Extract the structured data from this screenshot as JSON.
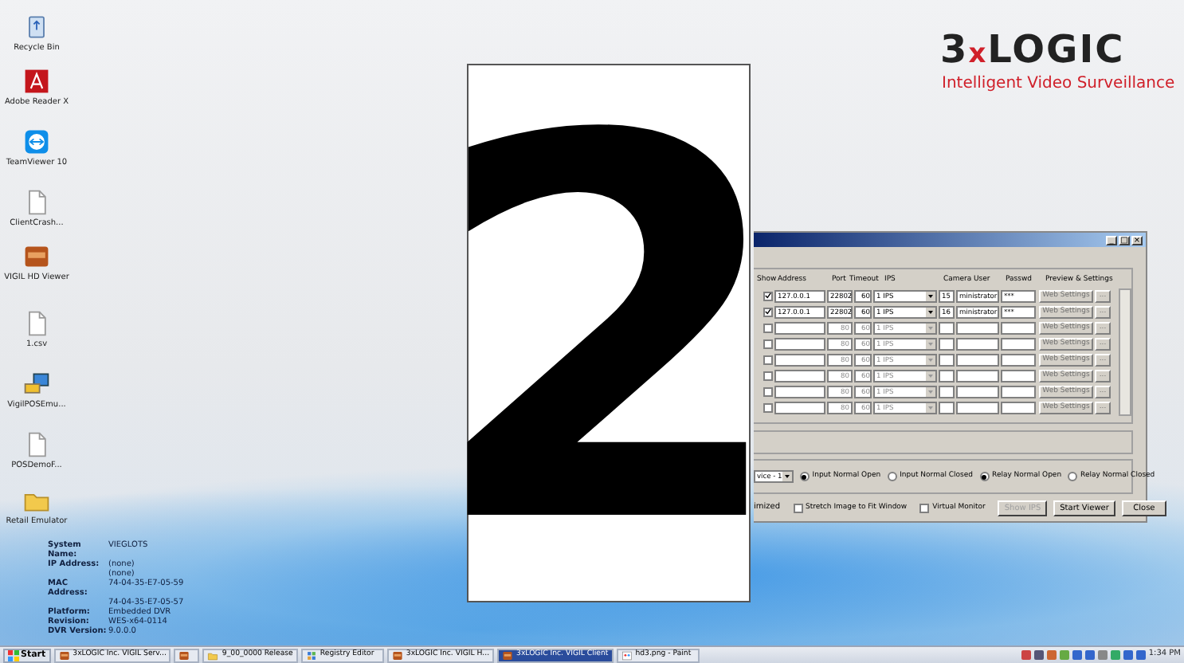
{
  "desktop_icons": [
    {
      "label": "Recycle Bin",
      "kind": "recycle"
    },
    {
      "label": "Adobe Reader X",
      "kind": "pdf"
    },
    {
      "label": "TeamViewer 10",
      "kind": "teamviewer"
    },
    {
      "label": "ClientCrash...",
      "kind": "file"
    },
    {
      "label": "VIGIL HD Viewer",
      "kind": "vigil"
    },
    {
      "label": "1.csv",
      "kind": "file"
    },
    {
      "label": "VigilPOSEmu...",
      "kind": "network"
    },
    {
      "label": "POSDemoF...",
      "kind": "file"
    },
    {
      "label": "Retail Emulator",
      "kind": "folder"
    }
  ],
  "system_info": [
    {
      "label": "System Name:",
      "values": [
        "VIEGLOTS"
      ]
    },
    {
      "label": "IP Address:",
      "values": [
        "(none)",
        "(none)"
      ]
    },
    {
      "label": "MAC Address:",
      "values": [
        "74-04-35-E7-05-59",
        "74-04-35-E7-05-57"
      ]
    },
    {
      "label": "Platform:",
      "values": [
        "Embedded DVR"
      ]
    },
    {
      "label": "Revision:",
      "values": [
        "WES-x64-0114"
      ]
    },
    {
      "label": "DVR Version:",
      "values": [
        "9.0.0.0"
      ]
    }
  ],
  "logo": {
    "before": "3",
    "accent": "x",
    "after": "LOGIC",
    "tagline": "Intelligent Video Surveillance"
  },
  "overlay": {
    "text": "2"
  },
  "dialog": {
    "title_buttons": [
      "_",
      "□",
      "×"
    ],
    "columns": [
      "Show",
      "Address",
      "Port",
      "Timeout",
      "IPS",
      "Camera",
      "User",
      "Passwd",
      "Preview & Settings"
    ],
    "rows": [
      {
        "show": true,
        "address": "127.0.0.1",
        "port": "22802",
        "timeout": "60",
        "ips": "1 IPS",
        "camera": "15",
        "user": "ministrator",
        "passwd": "***",
        "settings": "Web Settings",
        "more": "...",
        "enabled": true
      },
      {
        "show": true,
        "address": "127.0.0.1",
        "port": "22802",
        "timeout": "60",
        "ips": "1 IPS",
        "camera": "16",
        "user": "ministrator",
        "passwd": "***",
        "settings": "Web Settings",
        "more": "...",
        "enabled": true
      },
      {
        "show": false,
        "address": "",
        "port": "80",
        "timeout": "60",
        "ips": "1 IPS",
        "camera": "",
        "user": "",
        "passwd": "",
        "settings": "Web Settings",
        "more": "...",
        "enabled": false
      },
      {
        "show": false,
        "address": "",
        "port": "80",
        "timeout": "60",
        "ips": "1 IPS",
        "camera": "",
        "user": "",
        "passwd": "",
        "settings": "Web Settings",
        "more": "...",
        "enabled": false
      },
      {
        "show": false,
        "address": "",
        "port": "80",
        "timeout": "60",
        "ips": "1 IPS",
        "camera": "",
        "user": "",
        "passwd": "",
        "settings": "Web Settings",
        "more": "...",
        "enabled": false
      },
      {
        "show": false,
        "address": "",
        "port": "80",
        "timeout": "60",
        "ips": "1 IPS",
        "camera": "",
        "user": "",
        "passwd": "",
        "settings": "Web Settings",
        "more": "...",
        "enabled": false
      },
      {
        "show": false,
        "address": "",
        "port": "80",
        "timeout": "60",
        "ips": "1 IPS",
        "camera": "",
        "user": "",
        "passwd": "",
        "settings": "Web Settings",
        "more": "...",
        "enabled": false
      },
      {
        "show": false,
        "address": "",
        "port": "80",
        "timeout": "60",
        "ips": "1 IPS",
        "camera": "",
        "user": "",
        "passwd": "",
        "settings": "Web Settings",
        "more": "...",
        "enabled": false
      }
    ],
    "device_select": "vice - 1",
    "radios": [
      {
        "label": "Input Normal Open",
        "selected": true
      },
      {
        "label": "Input Normal Closed",
        "selected": false
      },
      {
        "label": "Relay Normal Open",
        "selected": true
      },
      {
        "label": "Relay Normal Closed",
        "selected": false
      }
    ],
    "cut_label": "imized",
    "checkboxes": [
      {
        "label": "Stretch Image to Fit Window",
        "checked": false
      },
      {
        "label": "Virtual Monitor",
        "checked": false
      }
    ],
    "buttons": [
      {
        "label": "Show IPS",
        "disabled": true
      },
      {
        "label": "Start Viewer",
        "disabled": false
      },
      {
        "label": "Close",
        "disabled": false
      }
    ]
  },
  "taskbar": {
    "start": "Start",
    "items": [
      {
        "label": "3xLOGIC Inc. VIGIL Serv...",
        "selected": false,
        "kind": "vigil"
      },
      {
        "selected": false,
        "kind": "vigil"
      },
      {
        "label": "9_00_0000 Release",
        "selected": false,
        "kind": "folder"
      },
      {
        "label": "Registry Editor",
        "selected": false,
        "kind": "registry"
      },
      {
        "label": "3xLOGIC Inc. VIGIL H...",
        "selected": false,
        "kind": "vigil"
      },
      {
        "label": "3xLOGIC Inc. VIGIL Client",
        "selected": true,
        "kind": "vigil"
      },
      {
        "label": "hd3.png - Paint",
        "selected": false,
        "kind": "paint"
      }
    ],
    "clock": "1:34 PM"
  }
}
